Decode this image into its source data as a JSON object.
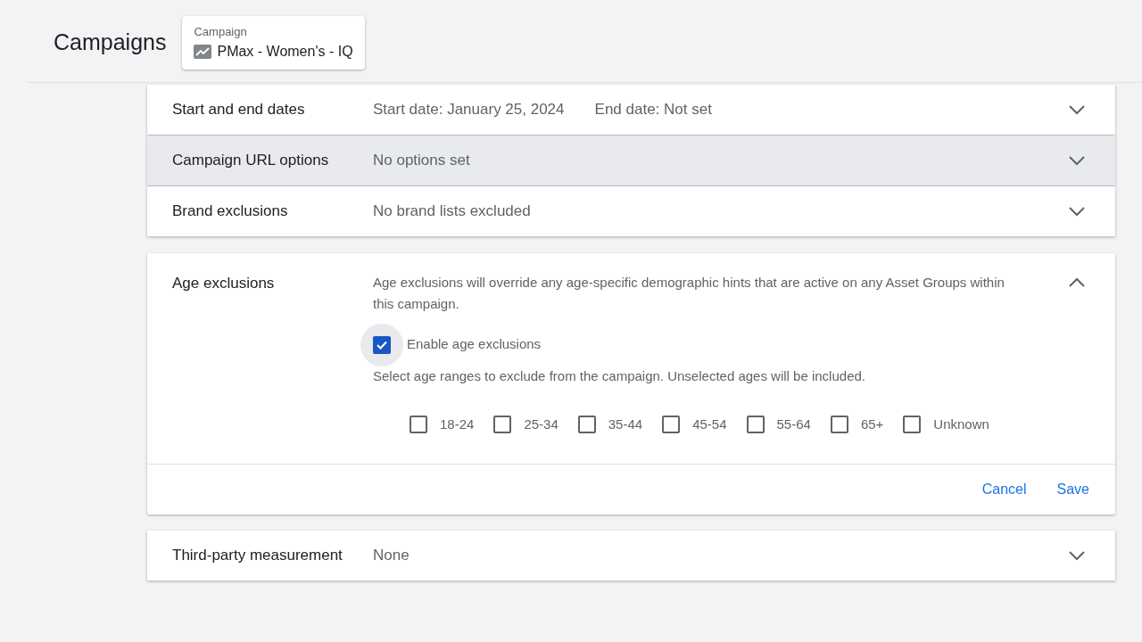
{
  "header": {
    "title": "Campaigns",
    "campaign_card": {
      "label": "Campaign",
      "name": "PMax - Women's - IQ"
    }
  },
  "sections": [
    {
      "title": "Start and end dates",
      "summary": [
        "Start date: January 25, 2024",
        "End date: Not set"
      ],
      "expanded": false,
      "highlighted": false
    },
    {
      "title": "Campaign URL options",
      "summary": [
        "No options set"
      ],
      "expanded": false,
      "highlighted": true
    },
    {
      "title": "Brand exclusions",
      "summary": [
        "No brand lists excluded"
      ],
      "expanded": false,
      "highlighted": false
    },
    {
      "title": "Age exclusions",
      "expanded": true,
      "highlighted": false,
      "description": "Age exclusions will override any age-specific demographic hints that are active on any Asset Groups within this campaign.",
      "enable": {
        "label": "Enable age exclusions",
        "checked": true
      },
      "hint": "Select age ranges to exclude from the campaign. Unselected ages will be included.",
      "ages": [
        {
          "label": "18-24",
          "checked": false
        },
        {
          "label": "25-34",
          "checked": false
        },
        {
          "label": "35-44",
          "checked": false
        },
        {
          "label": "45-54",
          "checked": false
        },
        {
          "label": "55-64",
          "checked": false
        },
        {
          "label": "65+",
          "checked": false
        },
        {
          "label": "Unknown",
          "checked": false
        }
      ],
      "actions": [
        "Cancel",
        "Save"
      ]
    },
    {
      "title": "Third-party measurement",
      "summary": [
        "None"
      ],
      "expanded": false,
      "highlighted": false
    }
  ]
}
